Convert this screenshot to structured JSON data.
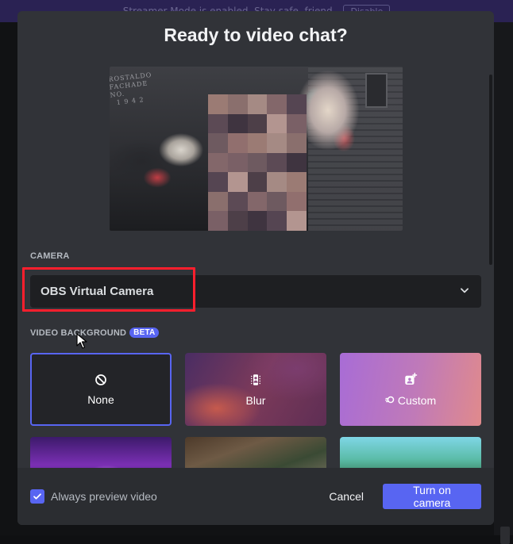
{
  "banner": {
    "text": "Streamer Mode is enabled. Stay safe, friend.",
    "button_label": "Disable"
  },
  "modal": {
    "title": "Ready to video chat?",
    "camera_section_label": "CAMERA",
    "camera_value": "OBS Virtual Camera",
    "video_bg_label": "VIDEO BACKGROUND",
    "beta_badge": "BETA",
    "backgrounds": [
      {
        "label": "None",
        "icon": "no-symbol-icon",
        "selected": true
      },
      {
        "label": "Blur",
        "icon": "blur-icon",
        "selected": false
      },
      {
        "label": "Custom",
        "icon": "image-add-icon",
        "selected": false
      }
    ],
    "footer": {
      "checkbox_label": "Always preview video",
      "checkbox_checked": true,
      "cancel_label": "Cancel",
      "primary_label": "Turn on camera"
    }
  },
  "colors": {
    "accent": "#5865f2",
    "highlight": "#ff1f2d",
    "modal_bg": "#313338"
  }
}
